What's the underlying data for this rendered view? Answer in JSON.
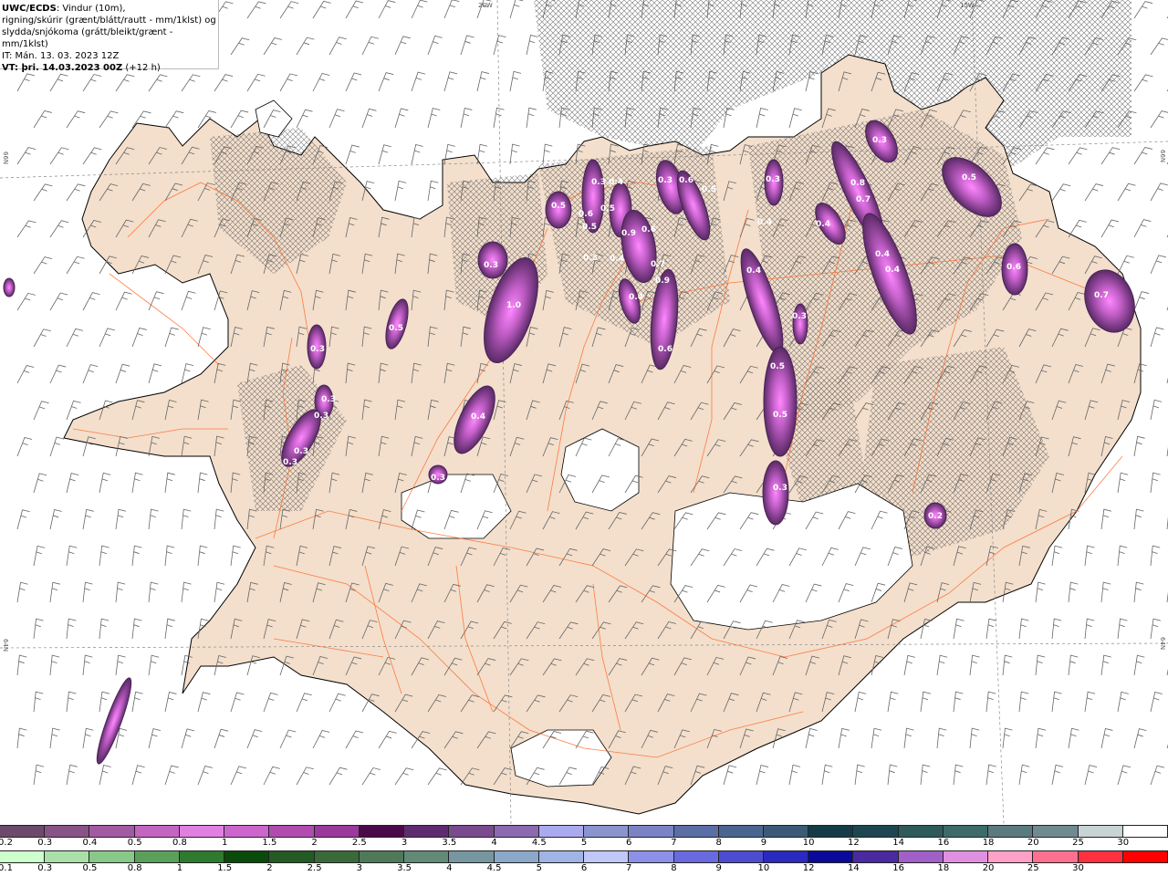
{
  "info": {
    "line1_bold": "UWC/ECDS",
    "line1_rest": ": Vindur (10m),",
    "line2": "rigning/skúrir (grænt/blátt/rautt - mm/1klst) og",
    "line3": "slydda/snjókoma (grátt/bleikt/grænt - mm/1klst)",
    "line4": "IT: Mán. 13. 03. 2023 12Z",
    "line5_bold": "VT: þri. 14.03.2023 00Z",
    "line5_rest": " (+12 h)"
  },
  "coords": {
    "top_a": "20W",
    "top_b": "15W",
    "left_a": "66N",
    "left_b": "64N",
    "right_a": "66N",
    "right_b": "64N"
  },
  "snow_legend": {
    "labels": [
      "0.2",
      "0.3",
      "0.4",
      "0.5",
      "0.8",
      "1",
      "1.5",
      "2",
      "2.5",
      "3",
      "3.5",
      "4",
      "4.5",
      "5",
      "6",
      "7",
      "8",
      "9",
      "10",
      "12",
      "14",
      "16",
      "18",
      "20",
      "25",
      "30"
    ],
    "colors": [
      "#6b4a6b",
      "#885488",
      "#a35aa3",
      "#c266c2",
      "#e080e0",
      "#cc66cc",
      "#b04cb0",
      "#9a3a9a",
      "#4a0a4a",
      "#5e2c6e",
      "#7a4a8e",
      "#8c6ab0",
      "#aaaaee",
      "#8c94d0",
      "#7a84c4",
      "#5c6ea6",
      "#4a6690",
      "#3c5a78",
      "#143c46",
      "#1e4650",
      "#2e5a5a",
      "#3e6a6a",
      "#5a7a80",
      "#708a90",
      "#c8d4d4",
      "#ffffff"
    ]
  },
  "rain_legend": {
    "labels": [
      "0.1",
      "0.3",
      "0.5",
      "0.8",
      "1",
      "1.5",
      "2",
      "2.5",
      "3",
      "3.5",
      "4",
      "4.5",
      "5",
      "6",
      "7",
      "8",
      "9",
      "10",
      "12",
      "14",
      "16",
      "18",
      "20",
      "25",
      "30"
    ],
    "colors": [
      "#ccffcc",
      "#aae0a8",
      "#88c888",
      "#5aa05a",
      "#2e7a2e",
      "#0a4a0a",
      "#245a24",
      "#3a6a3a",
      "#4e7a5a",
      "#628a76",
      "#7696a0",
      "#8ca8c8",
      "#a0b4e6",
      "#c0c8f8",
      "#8c90e8",
      "#6a6ae0",
      "#4c4cd0",
      "#2a2ac0",
      "#0a0a9a",
      "#4a2aa0",
      "#a060c8",
      "#e090e0",
      "#ffa0c8",
      "#ff7090",
      "#ff3040",
      "#ff0000"
    ]
  },
  "precip_labels": [
    "0.3",
    "0.3",
    "0.3",
    "0.3",
    "0.3",
    "0.3",
    "0.5",
    "0.3",
    "0.4",
    "1.0",
    "0.3",
    "0.5",
    "0.6",
    "0.5",
    "0.3",
    "0.4",
    "0.5",
    "0.4",
    "0.9",
    "0.6",
    "0.7",
    "0.4",
    "0.9",
    "0.6",
    "0.3",
    "0.6",
    "0.5",
    "0.4",
    "0.4",
    "0.3",
    "0.5",
    "0.3",
    "0.3",
    "0.8",
    "0.7",
    "0.4",
    "0.4",
    "0.4",
    "0.5",
    "0.6",
    "0.7",
    "0.2",
    "0.3",
    "0.5"
  ]
}
